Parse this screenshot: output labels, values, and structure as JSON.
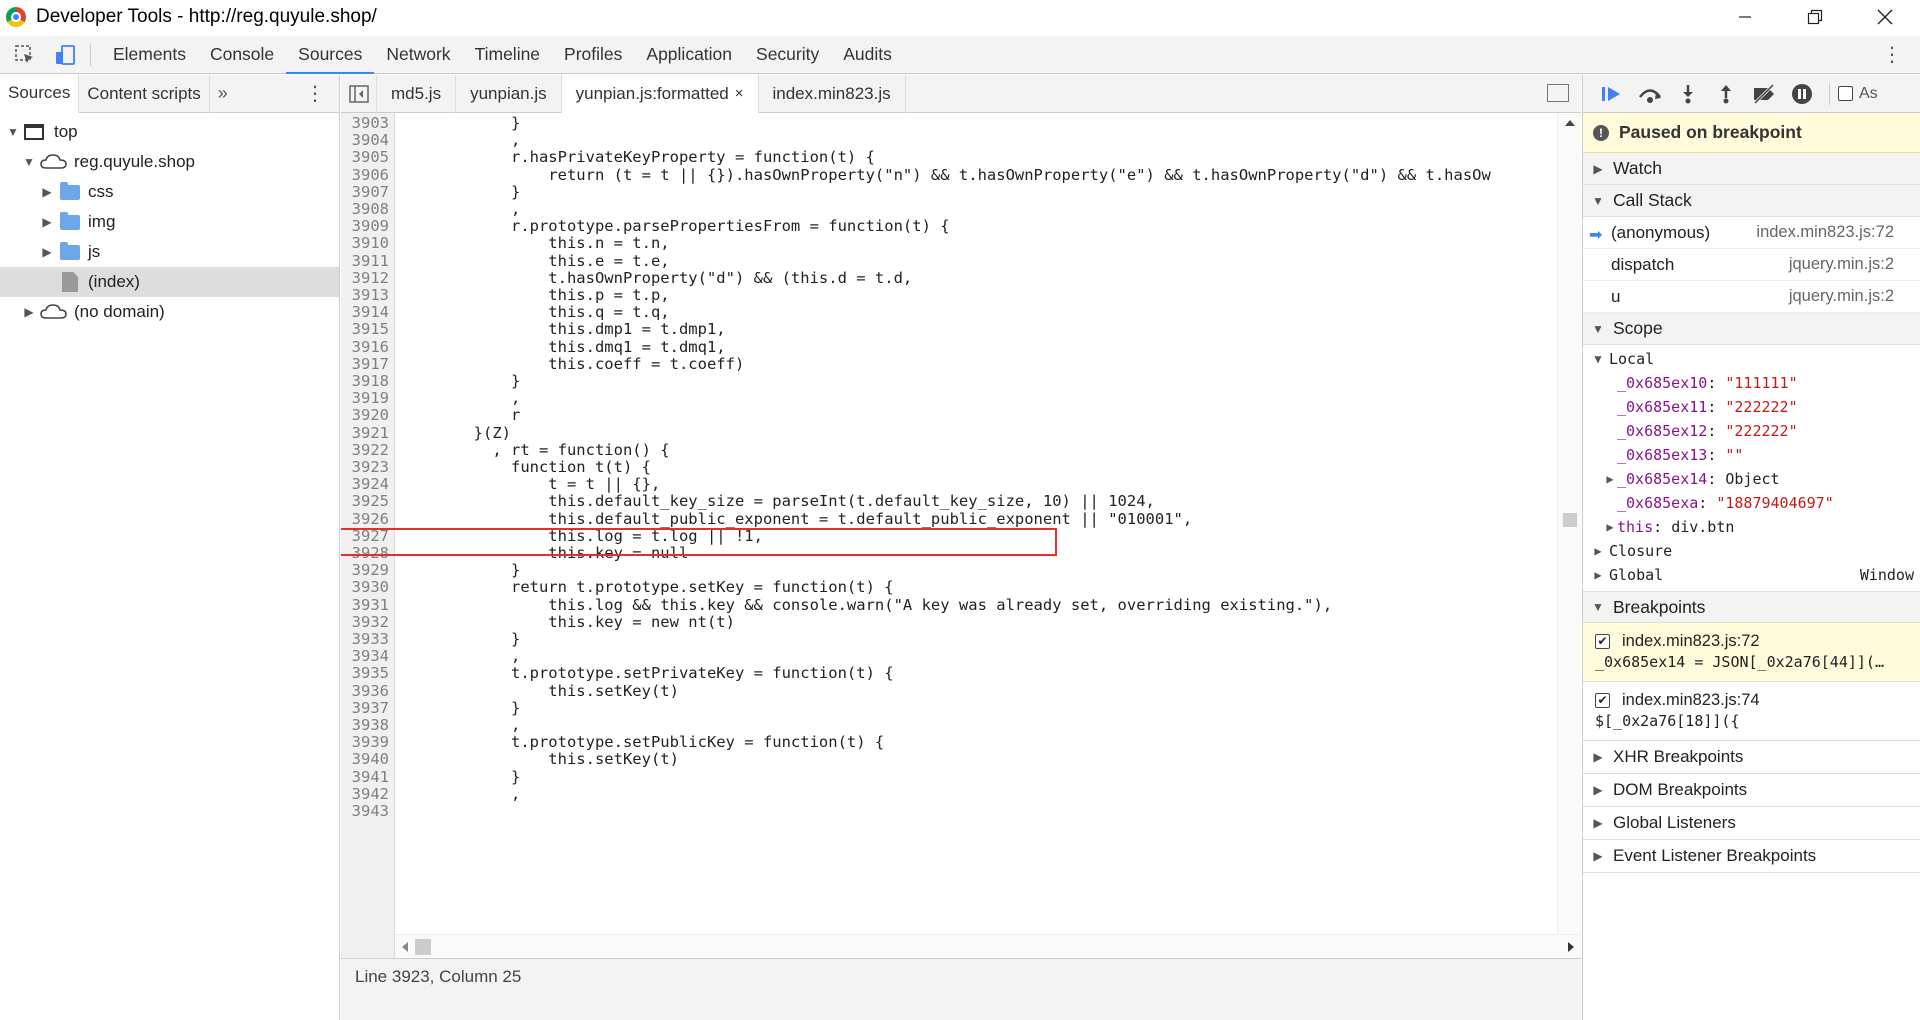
{
  "window": {
    "title": "Developer Tools - http://reg.quyule.shop/"
  },
  "main_tabs": [
    "Elements",
    "Console",
    "Sources",
    "Network",
    "Timeline",
    "Profiles",
    "Application",
    "Security",
    "Audits"
  ],
  "active_main_tab": "Sources",
  "left_panel": {
    "tabs": [
      "Sources",
      "Content scripts"
    ],
    "more": "»",
    "tree": [
      {
        "label": "top",
        "type": "frame",
        "depth": 0,
        "expanded": true
      },
      {
        "label": "reg.quyule.shop",
        "type": "cloud",
        "depth": 1,
        "expanded": true
      },
      {
        "label": "css",
        "type": "folder",
        "depth": 2,
        "expanded": false
      },
      {
        "label": "img",
        "type": "folder",
        "depth": 2,
        "expanded": false
      },
      {
        "label": "js",
        "type": "folder",
        "depth": 2,
        "expanded": false
      },
      {
        "label": "(index)",
        "type": "file",
        "depth": 2,
        "selected": true
      },
      {
        "label": "(no domain)",
        "type": "cloud",
        "depth": 1,
        "expanded": false
      }
    ]
  },
  "editor": {
    "tabs": [
      {
        "label": "md5.js",
        "active": false
      },
      {
        "label": "yunpian.js",
        "active": false
      },
      {
        "label": "yunpian.js:formatted",
        "active": true,
        "closable": true
      },
      {
        "label": "index.min823.js",
        "active": false
      }
    ],
    "close_glyph": "×",
    "lines": [
      {
        "n": "3903",
        "t": "            }"
      },
      {
        "n": "3904",
        "t": "            ,"
      },
      {
        "n": "3905",
        "t": "            r.hasPrivateKeyProperty = function(t) {"
      },
      {
        "n": "3906",
        "t": "                return (t = t || {}).hasOwnProperty(\"n\") && t.hasOwnProperty(\"e\") && t.hasOwnProperty(\"d\") && t.hasOw"
      },
      {
        "n": "3907",
        "t": "            }"
      },
      {
        "n": "3908",
        "t": "            ,"
      },
      {
        "n": "3909",
        "t": "            r.prototype.parsePropertiesFrom = function(t) {"
      },
      {
        "n": "3910",
        "t": "                this.n = t.n,"
      },
      {
        "n": "3911",
        "t": "                this.e = t.e,"
      },
      {
        "n": "3912",
        "t": "                t.hasOwnProperty(\"d\") && (this.d = t.d,"
      },
      {
        "n": "3913",
        "t": "                this.p = t.p,"
      },
      {
        "n": "3914",
        "t": "                this.q = t.q,"
      },
      {
        "n": "3915",
        "t": "                this.dmp1 = t.dmp1,"
      },
      {
        "n": "3916",
        "t": "                this.dmq1 = t.dmq1,"
      },
      {
        "n": "3917",
        "t": "                this.coeff = t.coeff)"
      },
      {
        "n": "3918",
        "t": "            }"
      },
      {
        "n": "3919",
        "t": "            ,"
      },
      {
        "n": "3920",
        "t": "            r"
      },
      {
        "n": "3921",
        "t": "        }(Z)"
      },
      {
        "n": "3922",
        "t": "          , rt = function() {"
      },
      {
        "n": "3923",
        "t": "            function t(t) {"
      },
      {
        "n": "3924",
        "t": "                t = t || {},"
      },
      {
        "n": "3925",
        "t": "                this.default_key_size = parseInt(t.default_key_size, 10) || 1024,"
      },
      {
        "n": "3926",
        "t": "                this.default_public_exponent = t.default_public_exponent || \"010001\","
      },
      {
        "n": "3927",
        "t": "                this.log = t.log || !1,"
      },
      {
        "n": "3928",
        "t": "                this.key = null"
      },
      {
        "n": "3929",
        "t": "            }"
      },
      {
        "n": "3930",
        "t": "            return t.prototype.setKey = function(t) {"
      },
      {
        "n": "3931",
        "t": "                this.log && this.key && console.warn(\"A key was already set, overriding existing.\"),"
      },
      {
        "n": "3932",
        "t": "                this.key = new nt(t)"
      },
      {
        "n": "3933",
        "t": "            }"
      },
      {
        "n": "3934",
        "t": "            ,"
      },
      {
        "n": "3935",
        "t": "            t.prototype.setPrivateKey = function(t) {"
      },
      {
        "n": "3936",
        "t": "                this.setKey(t)"
      },
      {
        "n": "3937",
        "t": "            }"
      },
      {
        "n": "3938",
        "t": "            ,"
      },
      {
        "n": "3939",
        "t": "            t.prototype.setPublicKey = function(t) {"
      },
      {
        "n": "3940",
        "t": "                this.setKey(t)"
      },
      {
        "n": "3941",
        "t": "            }"
      },
      {
        "n": "3942",
        "t": "            ,"
      },
      {
        "n": "3943",
        "t": ""
      }
    ],
    "status": "Line 3923, Column 25"
  },
  "debugger": {
    "paused_text": "Paused on breakpoint",
    "watch_label": "Watch",
    "callstack_label": "Call Stack",
    "callstack": [
      {
        "fn": "(anonymous)",
        "loc": "index.min823.js:72",
        "current": true
      },
      {
        "fn": "dispatch",
        "loc": "jquery.min.js:2",
        "current": false
      },
      {
        "fn": "u",
        "loc": "jquery.min.js:2",
        "current": false
      }
    ],
    "scope_label": "Scope",
    "local_label": "Local",
    "local_vars": [
      {
        "name": "_0x685ex10",
        "value": "\"111111\"",
        "kind": "string"
      },
      {
        "name": "_0x685ex11",
        "value": "\"222222\"",
        "kind": "string"
      },
      {
        "name": "_0x685ex12",
        "value": "\"222222\"",
        "kind": "string"
      },
      {
        "name": "_0x685ex13",
        "value": "\"\"",
        "kind": "string"
      },
      {
        "name": "_0x685ex14",
        "value": "Object",
        "kind": "object",
        "expandable": true
      },
      {
        "name": "_0x685exa",
        "value": "\"18879404697\"",
        "kind": "string"
      },
      {
        "name": "this",
        "value": "div.btn",
        "kind": "object",
        "expandable": true
      }
    ],
    "closure_label": "Closure",
    "global_label": "Global",
    "global_value": "Window",
    "breakpoints_label": "Breakpoints",
    "breakpoints": [
      {
        "loc": "index.min823.js:72",
        "code": "_0x685ex14 = JSON[_0x2a76[44]](…",
        "active": true
      },
      {
        "loc": "index.min823.js:74",
        "code": "$[_0x2a76[18]]({",
        "active": false
      }
    ],
    "more_sections": [
      "XHR Breakpoints",
      "DOM Breakpoints",
      "Global Listeners",
      "Event Listener Breakpoints"
    ],
    "async_label": "As"
  }
}
